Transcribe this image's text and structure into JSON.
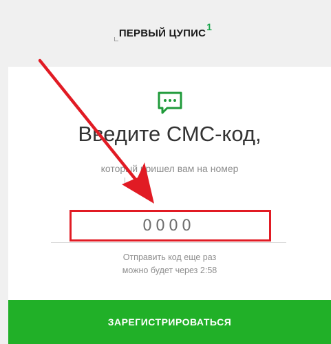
{
  "header": {
    "logo_text": "ПЕРВЫЙ ЦУПИС",
    "logo_superscript": "1"
  },
  "icons": {
    "sms": "chat-bubble-dots-icon"
  },
  "colors": {
    "accent_green": "#21b028",
    "annotation_red": "#e11b24"
  },
  "form": {
    "title": "Введите СМС-код,",
    "subtitle": "который пришел вам на номер",
    "code_placeholder": "0000",
    "resend_line1": "Отправить код еще раз",
    "resend_line2": "можно будет через 2:58",
    "register_label": "ЗАРЕГИСТРИРОВАТЬСЯ"
  }
}
